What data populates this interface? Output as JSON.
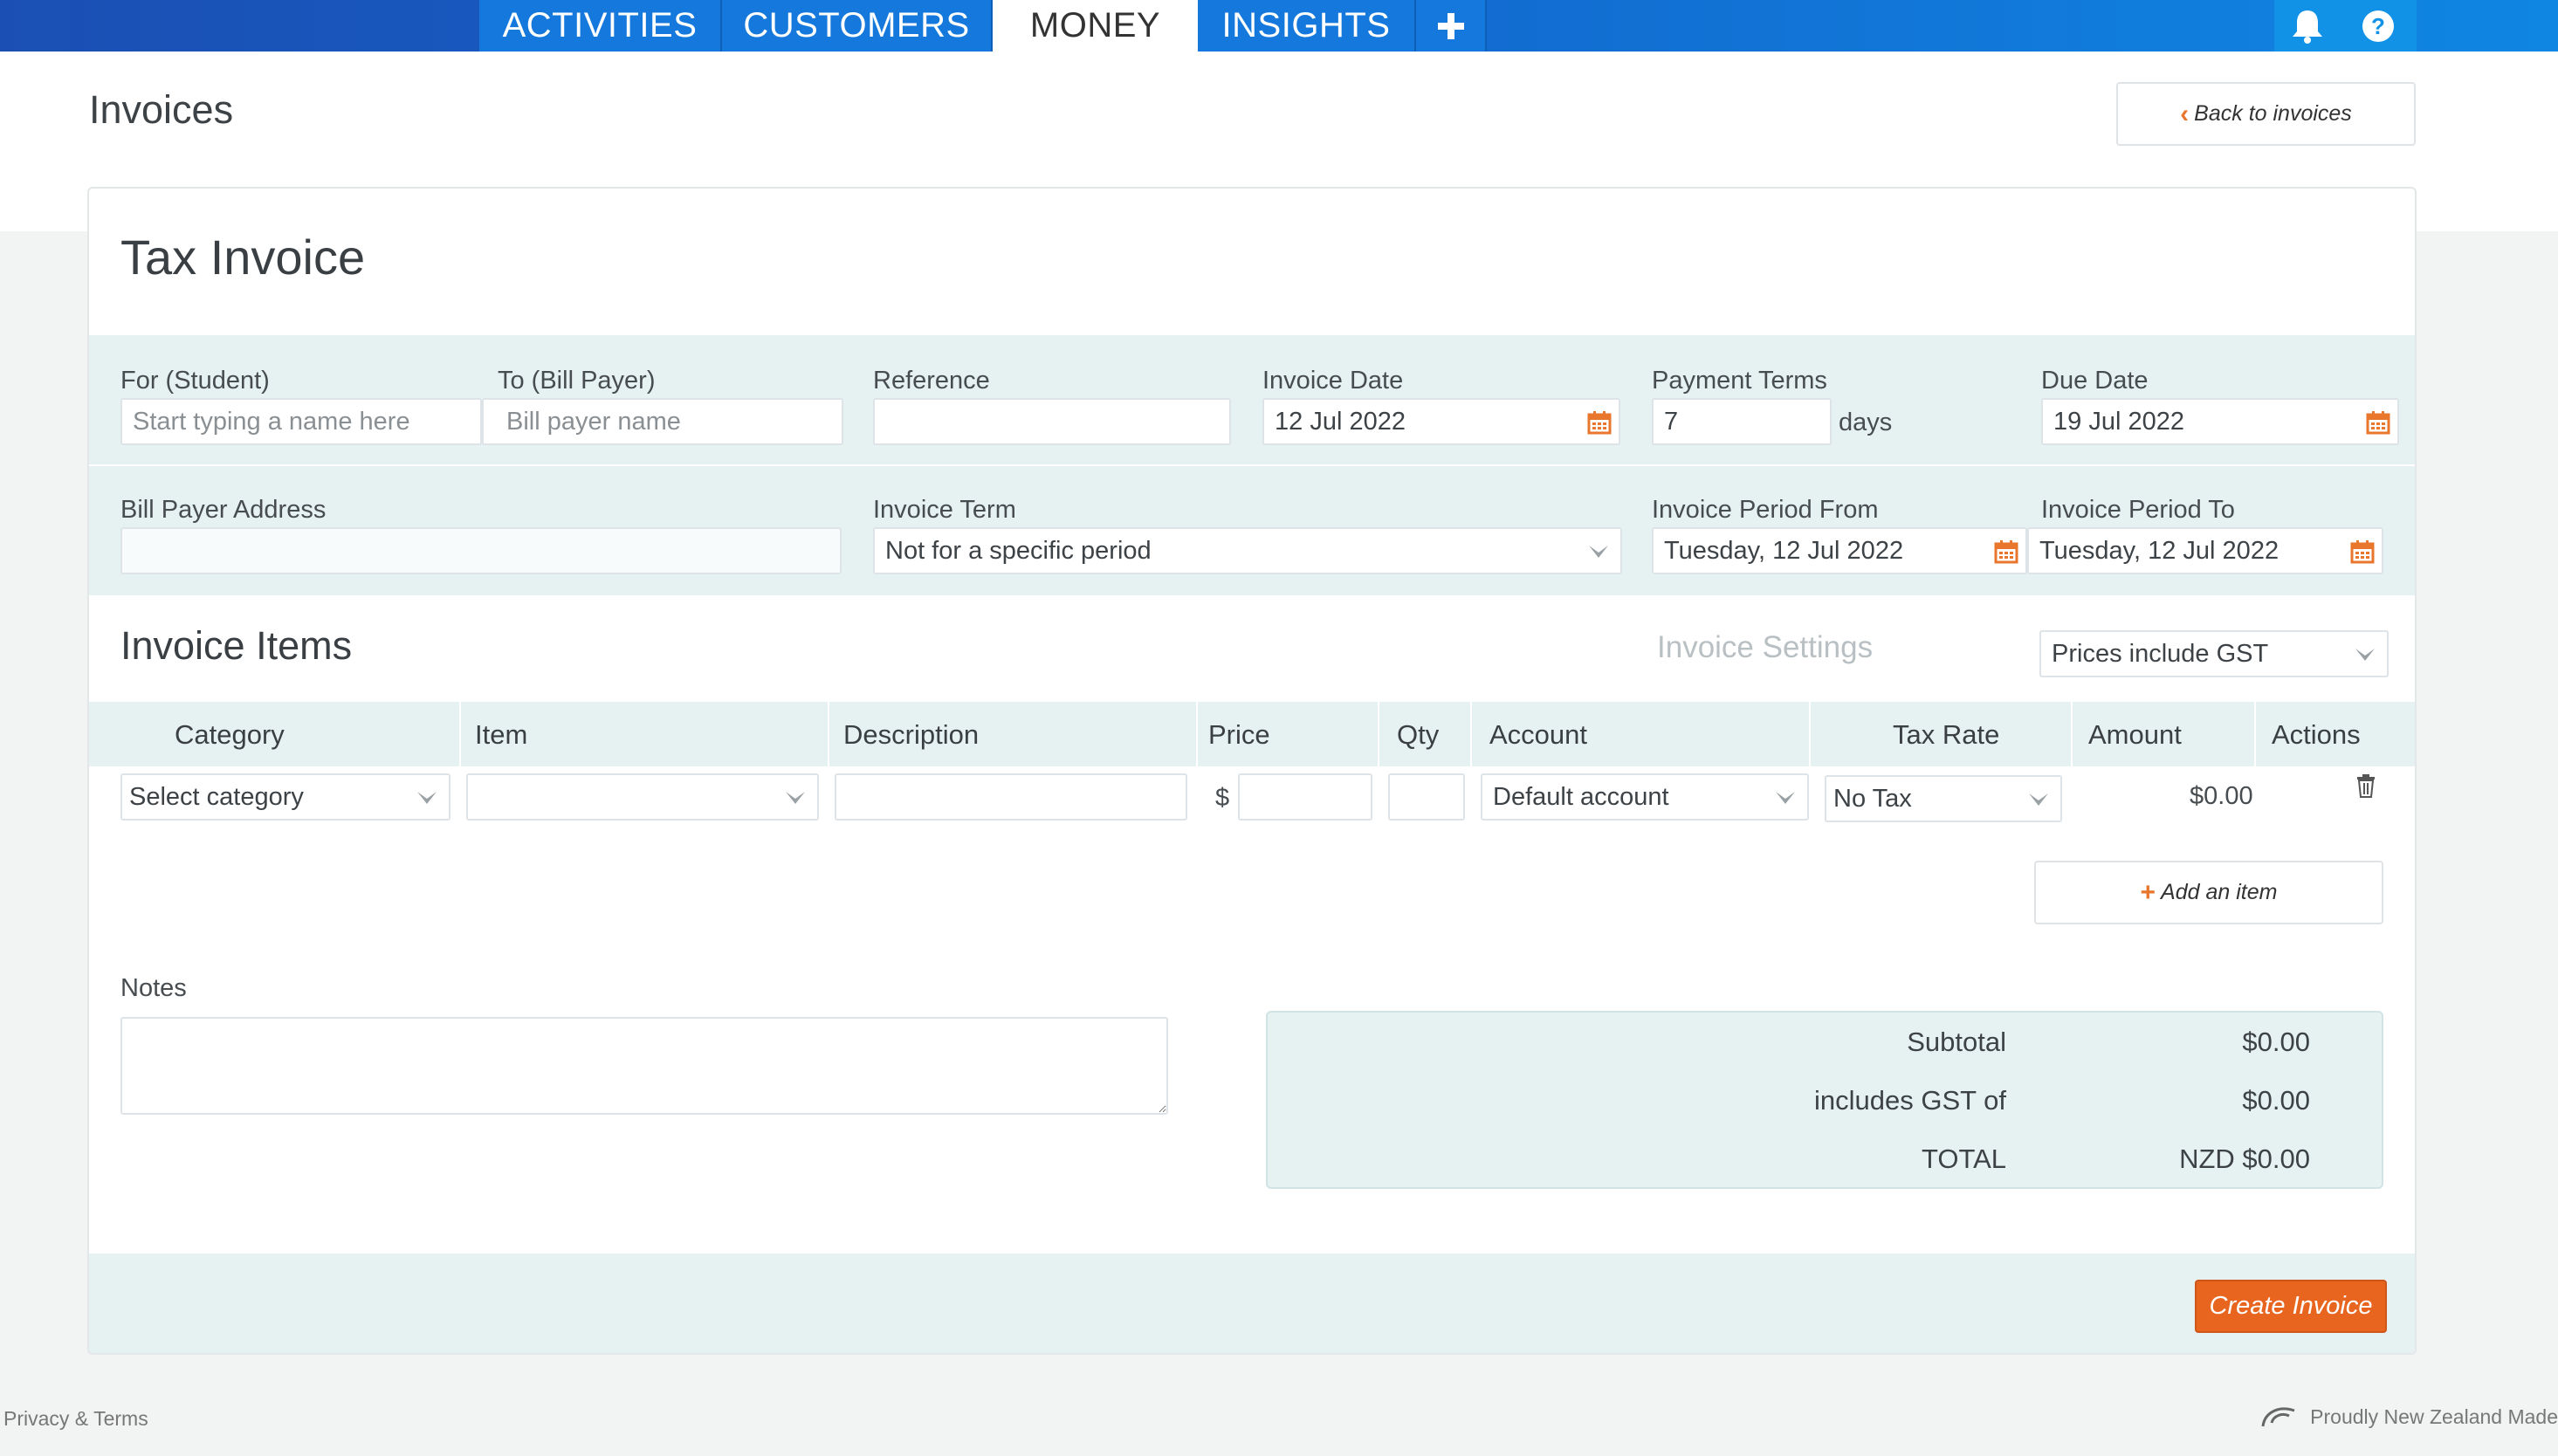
{
  "nav": {
    "tabs": [
      "ACTIVITIES",
      "CUSTOMERS",
      "MONEY",
      "INSIGHTS"
    ],
    "active_tab": "MONEY",
    "icons": [
      "plus-icon",
      "bell-icon",
      "help-icon"
    ]
  },
  "header": {
    "page_title": "Invoices",
    "back_label": "Back to invoices"
  },
  "invoice": {
    "title": "Tax Invoice",
    "for_student": {
      "label": "For (Student)",
      "placeholder": "Start typing a name here",
      "value": ""
    },
    "to_bill_payer": {
      "label": "To (Bill Payer)",
      "placeholder": "Bill payer name",
      "value": ""
    },
    "reference": {
      "label": "Reference",
      "value": ""
    },
    "invoice_date": {
      "label": "Invoice Date",
      "value": "12 Jul 2022"
    },
    "payment_terms": {
      "label": "Payment Terms",
      "value": "7",
      "suffix": "days"
    },
    "due_date": {
      "label": "Due Date",
      "value": "19 Jul 2022"
    },
    "bill_payer_address": {
      "label": "Bill Payer Address",
      "value": ""
    },
    "invoice_term": {
      "label": "Invoice Term",
      "value": "Not for a specific period"
    },
    "period_from": {
      "label": "Invoice Period From",
      "value": "Tuesday, 12 Jul 2022"
    },
    "period_to": {
      "label": "Invoice Period To",
      "value": "Tuesday, 12 Jul 2022"
    }
  },
  "items": {
    "section_title": "Invoice Items",
    "settings_link": "Invoice Settings",
    "gst_mode": "Prices include GST",
    "columns": [
      "Category",
      "Item",
      "Description",
      "Price",
      "Qty",
      "Account",
      "Tax Rate",
      "Amount",
      "Actions"
    ],
    "rows": [
      {
        "category": "Select category",
        "item": "",
        "description": "",
        "currency": "$",
        "price": "",
        "qty": "",
        "account": "Default account",
        "tax_rate": "No Tax",
        "amount": "$0.00"
      }
    ],
    "add_label": "Add an item"
  },
  "notes": {
    "label": "Notes",
    "value": ""
  },
  "totals": {
    "subtotal_label": "Subtotal",
    "subtotal": "$0.00",
    "gst_label": "includes GST of",
    "gst": "$0.00",
    "total_label": "TOTAL",
    "total": "NZD $0.00"
  },
  "actions": {
    "create_label": "Create Invoice"
  },
  "footer": {
    "privacy": "Privacy & Terms",
    "made_in": "Proudly New Zealand Made"
  },
  "colors": {
    "accent": "#e8651f",
    "nav": "#1478dc",
    "band": "#e6f1f2"
  }
}
